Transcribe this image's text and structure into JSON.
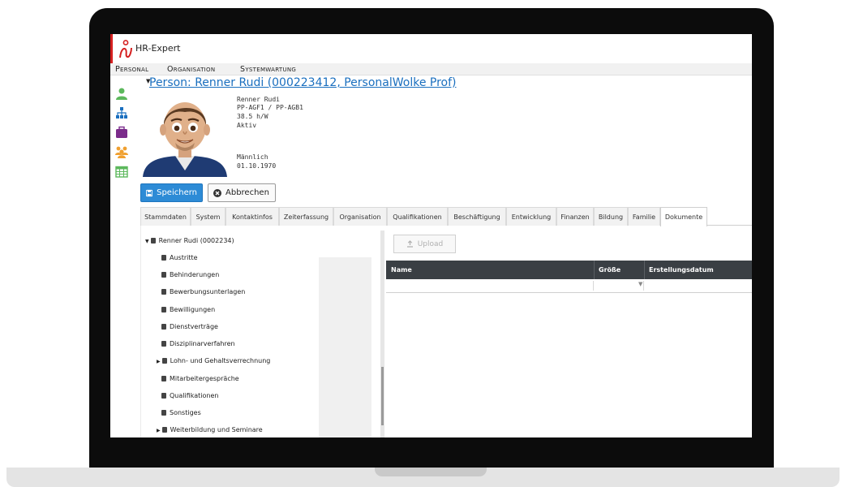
{
  "app": {
    "name": "HR-Expert"
  },
  "menu": [
    "Personal",
    "Organisation",
    "Systemwartung"
  ],
  "sidebar_icons": [
    "person-icon",
    "org-chart-icon",
    "briefcase-icon",
    "group-icon",
    "calendar-icon"
  ],
  "colors": {
    "accent": "#d52020",
    "link": "#1a6fbf",
    "primary_button": "#2d8bd6",
    "grid_header": "#3a3f44",
    "icon_green": "#5cb85c",
    "icon_purple": "#7b2c8b",
    "icon_orange": "#f0a030"
  },
  "person": {
    "title": "Person: Renner Rudi (000223412, PersonalWolke Prof)",
    "name": "Renner Rudi",
    "position": "PP-AGF1 / PP-AGB1",
    "hours": "38.5 h/W",
    "status": "Aktiv",
    "gender": "Männlich",
    "birthdate": "01.10.1970"
  },
  "actions": {
    "save": "Speichern",
    "cancel": "Abbrechen"
  },
  "tabs": [
    {
      "label": "Stammdaten",
      "active": false
    },
    {
      "label": "System",
      "active": false
    },
    {
      "label": "Kontaktinfos",
      "active": false
    },
    {
      "label": "Zeiterfassung",
      "active": false
    },
    {
      "label": "Organisation",
      "active": false
    },
    {
      "label": "Qualifikationen",
      "active": false
    },
    {
      "label": "Beschäftigung",
      "active": false
    },
    {
      "label": "Entwicklung",
      "active": false
    },
    {
      "label": "Finanzen",
      "active": false
    },
    {
      "label": "Bildung",
      "active": false
    },
    {
      "label": "Familie",
      "active": false
    },
    {
      "label": "Dokumente",
      "active": true
    }
  ],
  "tree": {
    "root": "Renner Rudi (0002234)",
    "items": [
      {
        "label": "Austritte",
        "expandable": false
      },
      {
        "label": "Behinderungen",
        "expandable": false
      },
      {
        "label": "Bewerbungsunterlagen",
        "expandable": false
      },
      {
        "label": "Bewilligungen",
        "expandable": false
      },
      {
        "label": "Dienstverträge",
        "expandable": false
      },
      {
        "label": "Disziplinarverfahren",
        "expandable": false
      },
      {
        "label": "Lohn- und Gehaltsverrechnung",
        "expandable": true
      },
      {
        "label": "Mitarbeitergespräche",
        "expandable": false
      },
      {
        "label": "Qualifikationen",
        "expandable": false
      },
      {
        "label": "Sonstiges",
        "expandable": false
      },
      {
        "label": "Weiterbildung und Seminare",
        "expandable": true
      }
    ]
  },
  "documents": {
    "upload": "Upload",
    "columns": [
      "Name",
      "Größe",
      "Erstellungsdatum"
    ]
  }
}
